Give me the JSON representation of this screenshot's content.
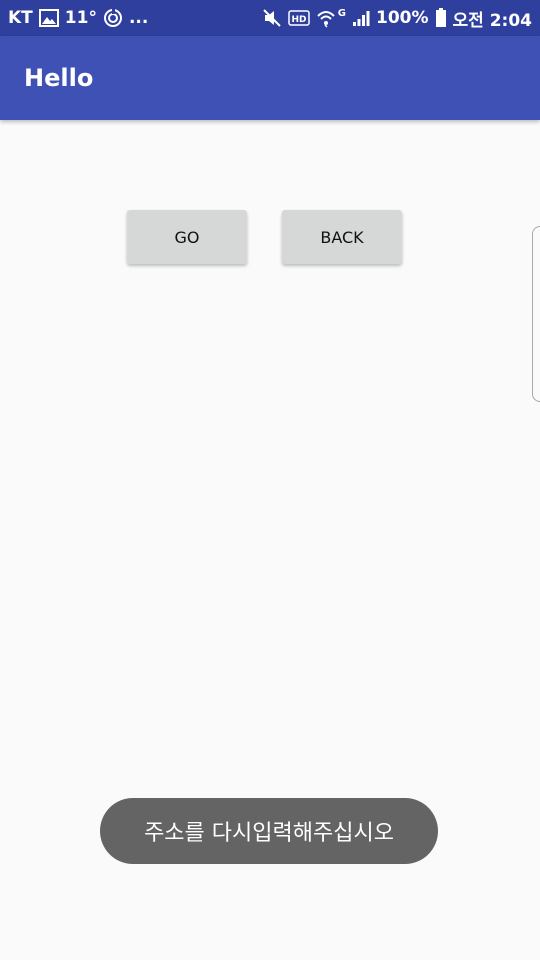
{
  "status_bar": {
    "carrier": "KT",
    "temperature": "11°",
    "ellipsis": "...",
    "network_type": "G",
    "battery": "100%",
    "time": "오전 2:04"
  },
  "app_bar": {
    "title": "Hello"
  },
  "buttons": {
    "go_label": "GO",
    "back_label": "BACK"
  },
  "toast": {
    "message": "주소를 다시입력해주십시오"
  },
  "colors": {
    "status_bar": "#2f3f9e",
    "app_bar": "#3f51b5",
    "background": "#fafafa",
    "button": "#d6d7d7",
    "toast": "#646464"
  }
}
